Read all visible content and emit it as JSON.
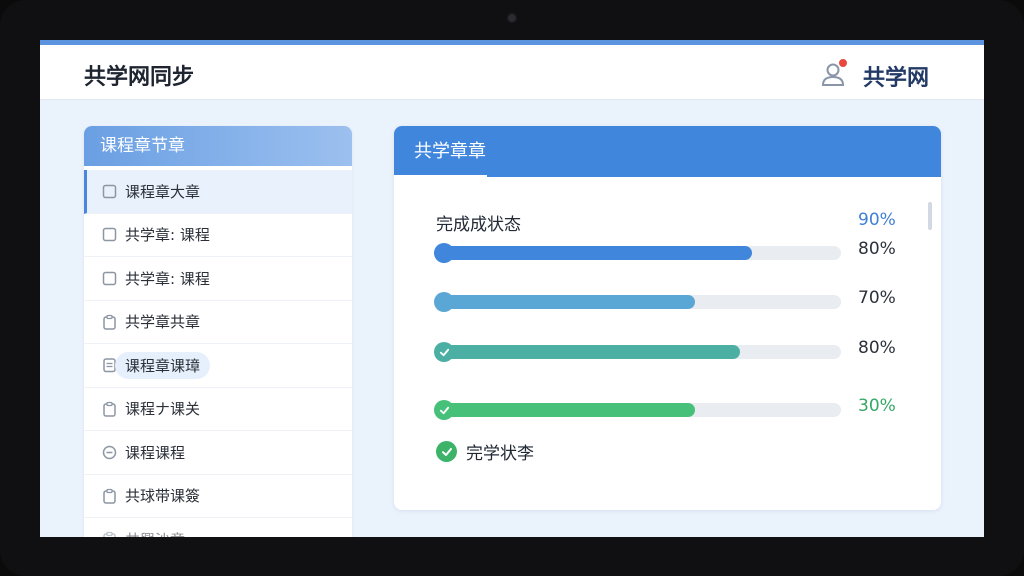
{
  "header": {
    "app_title": "共学网同步",
    "brand": "共学网",
    "icons": {
      "user": "user-icon",
      "notification": "notification-dot"
    }
  },
  "sidebar": {
    "title": "课程章节章",
    "items": [
      {
        "label": "课程章大章",
        "icon": "checkbox-icon",
        "state": "active"
      },
      {
        "label": "共学章: 课程",
        "icon": "checkbox-icon",
        "state": "normal"
      },
      {
        "label": "共学章: 课程",
        "icon": "checkbox-icon",
        "state": "normal"
      },
      {
        "label": "共学章共章",
        "icon": "clipboard-icon",
        "state": "normal"
      },
      {
        "label": "课程章课璋",
        "icon": "document-icon",
        "state": "hover"
      },
      {
        "label": "课程ナ课关",
        "icon": "clipboard-icon",
        "state": "normal"
      },
      {
        "label": "课程课程",
        "icon": "circle-minus-icon",
        "state": "normal"
      },
      {
        "label": "共球带课簽",
        "icon": "clipboard-icon",
        "state": "normal"
      },
      {
        "label": "共興沙章",
        "icon": "clipboard-icon",
        "state": "faded"
      }
    ]
  },
  "panel": {
    "title": "共学章章",
    "status_label": "完成成状态",
    "top_percent": "90%",
    "bars": [
      {
        "percent_text": "80%",
        "progress": 0.78,
        "color": "#3f86dc",
        "knob": "dot",
        "pct_color": "#2b313b"
      },
      {
        "percent_text": "70%",
        "progress": 0.64,
        "color": "#5aa7d6",
        "knob": "dot",
        "pct_color": "#2b313b"
      },
      {
        "percent_text": "80%",
        "progress": 0.75,
        "color": "#4bb0a3",
        "knob": "check",
        "pct_color": "#2b313b"
      },
      {
        "percent_text": "30%",
        "progress": 0.64,
        "color": "#47c17a",
        "knob": "check",
        "pct_color": "#36a866"
      }
    ],
    "complete_label": "完学状李"
  },
  "colors": {
    "accent": "#3f86dc",
    "success": "#3db36a",
    "screen_bg": "#eaf2fc"
  }
}
